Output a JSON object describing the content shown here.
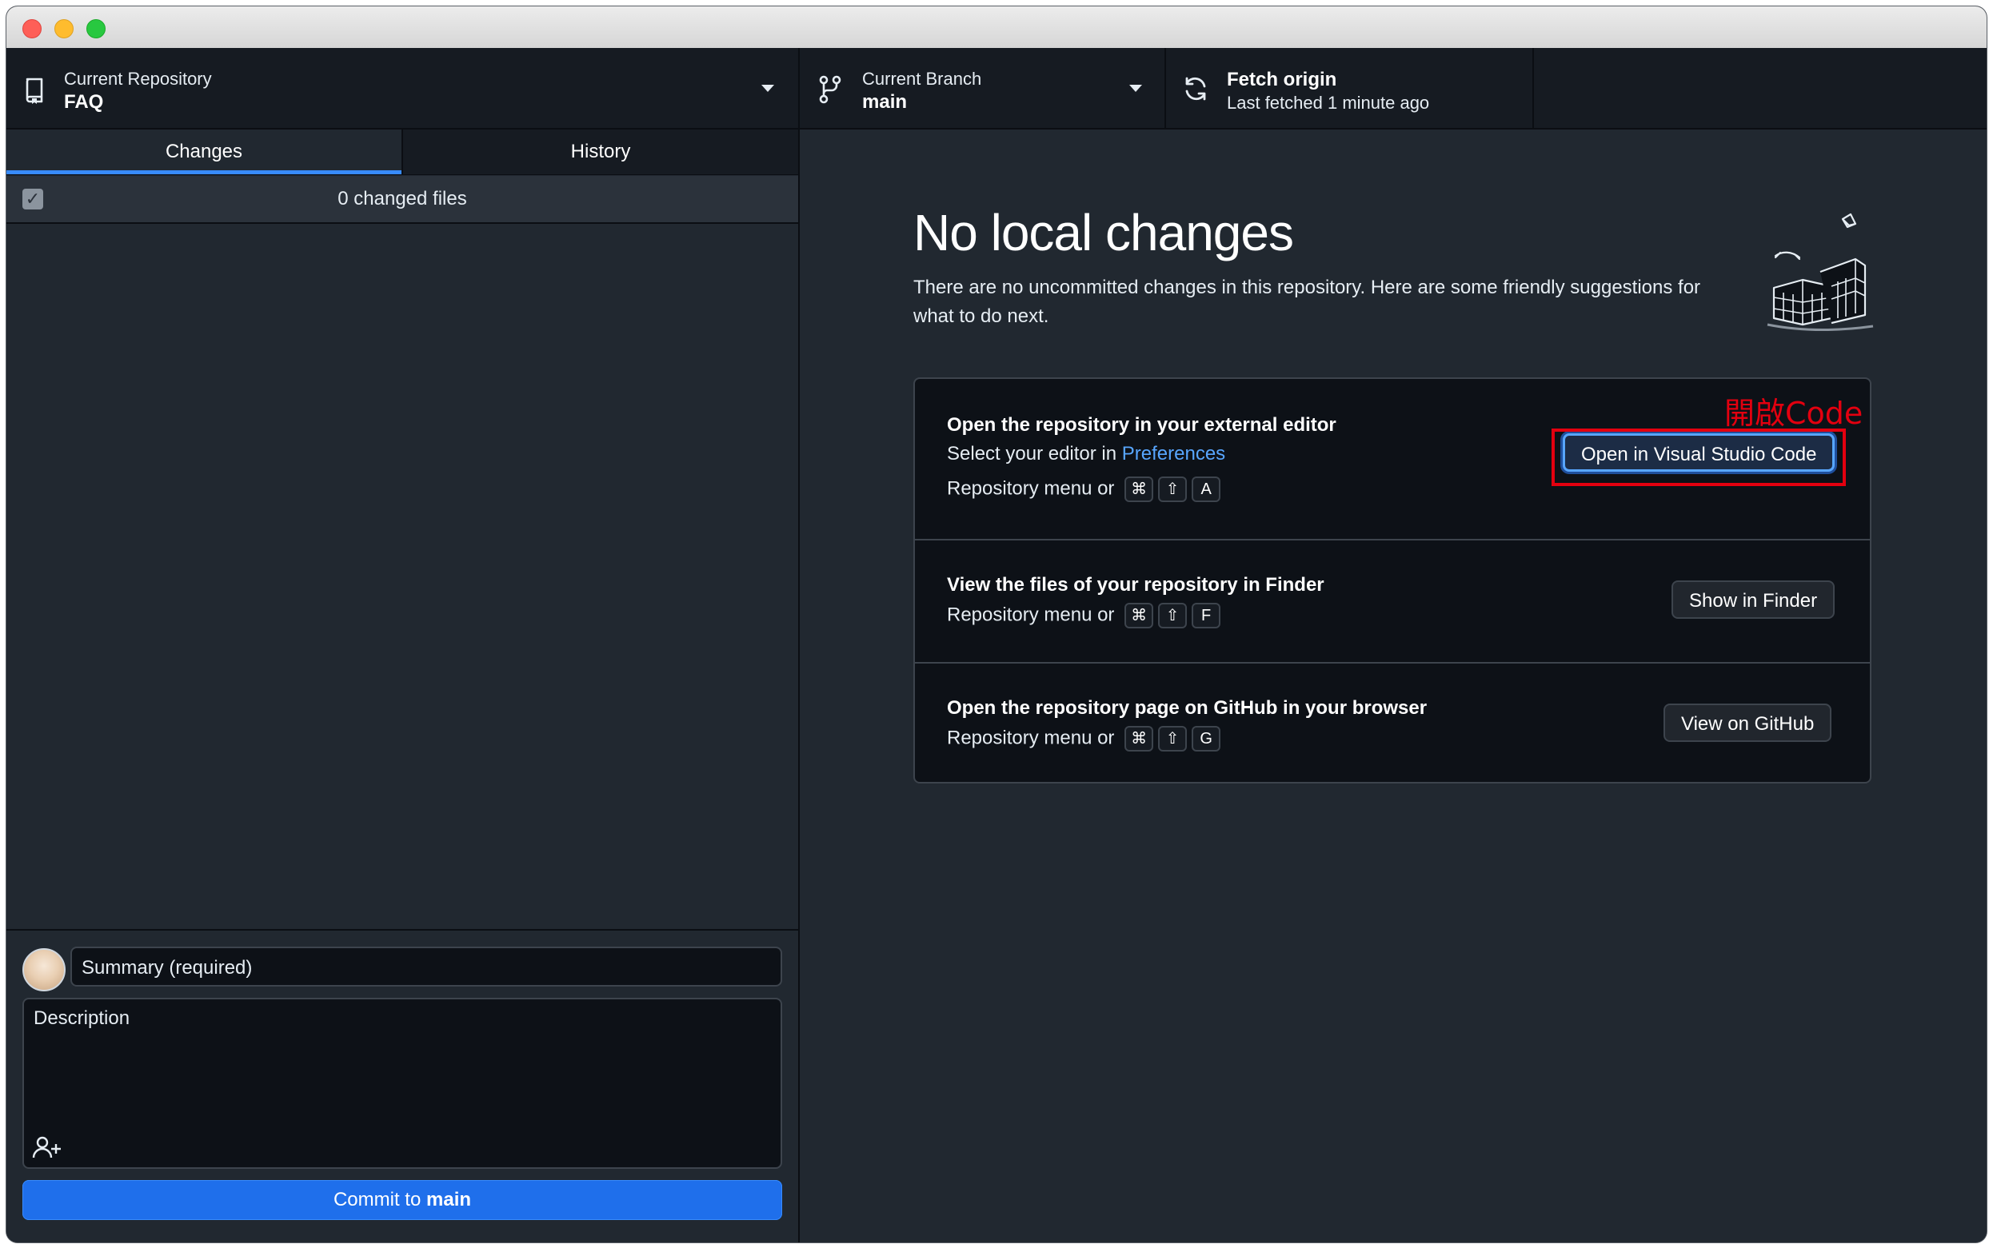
{
  "colors": {
    "accent": "#388bfd",
    "commit_button": "#1f6feb",
    "link": "#58a6ff",
    "annotation": "#e3000f",
    "background": "#212830"
  },
  "toolbar": {
    "repository": {
      "caption": "Current Repository",
      "name": "FAQ",
      "icon": "repo-icon"
    },
    "branch": {
      "caption": "Current Branch",
      "name": "main",
      "icon": "branch-icon"
    },
    "fetch": {
      "title": "Fetch origin",
      "subtitle": "Last fetched 1 minute ago",
      "icon": "sync-icon"
    }
  },
  "sidebar": {
    "tabs": [
      {
        "label": "Changes",
        "active": true
      },
      {
        "label": "History",
        "active": false
      }
    ],
    "changed_files": "0 changed files"
  },
  "commit": {
    "summary_placeholder": "Summary (required)",
    "description_placeholder": "Description",
    "button_prefix": "Commit to",
    "button_branch": "main"
  },
  "main": {
    "title": "No local changes",
    "description": "There are no uncommitted changes in this repository. Here are some friendly suggestions for what to do next.",
    "suggestions": [
      {
        "title": "Open the repository in your external editor",
        "line1_prefix": "Select your editor in",
        "line1_link": "Preferences",
        "menu_text": "Repository menu or",
        "keys": [
          "⌘",
          "⇧",
          "A"
        ],
        "button": "Open in Visual Studio Code"
      },
      {
        "title": "View the files of your repository in Finder",
        "menu_text": "Repository menu or",
        "keys": [
          "⌘",
          "⇧",
          "F"
        ],
        "button": "Show in Finder"
      },
      {
        "title": "Open the repository page on GitHub in your browser",
        "menu_text": "Repository menu or",
        "keys": [
          "⌘",
          "⇧",
          "G"
        ],
        "button": "View on GitHub"
      }
    ]
  },
  "annotation": {
    "label": "開啟Code"
  }
}
